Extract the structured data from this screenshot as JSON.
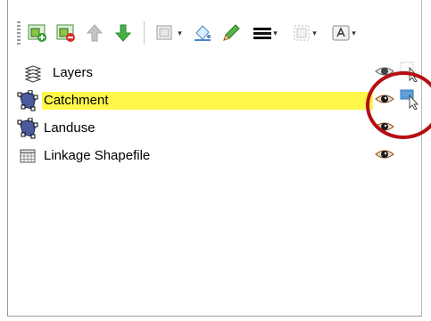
{
  "layers_panel": {
    "toolbar": {
      "buttons": [
        {
          "name": "add-group-icon"
        },
        {
          "name": "remove-layer-icon"
        },
        {
          "name": "move-up-icon"
        },
        {
          "name": "move-down-icon"
        },
        {
          "name": "symbology-dropdown-icon"
        },
        {
          "name": "fill-color-icon"
        },
        {
          "name": "edit-pencil-icon"
        },
        {
          "name": "line-style-dropdown-icon"
        },
        {
          "name": "frame-dropdown-icon"
        },
        {
          "name": "label-dropdown-icon"
        }
      ]
    },
    "header_label": "Layers",
    "layers": [
      {
        "label": "Catchment",
        "selected": true
      },
      {
        "label": "Landuse",
        "selected": false
      },
      {
        "label": "Linkage Shapefile",
        "selected": false
      }
    ]
  },
  "colors": {
    "selection_highlight": "#fff84a",
    "annotation_circle": "#b50f12",
    "move_down_arrow": "#3aa33a",
    "move_up_arrow": "#b8b8b8"
  }
}
